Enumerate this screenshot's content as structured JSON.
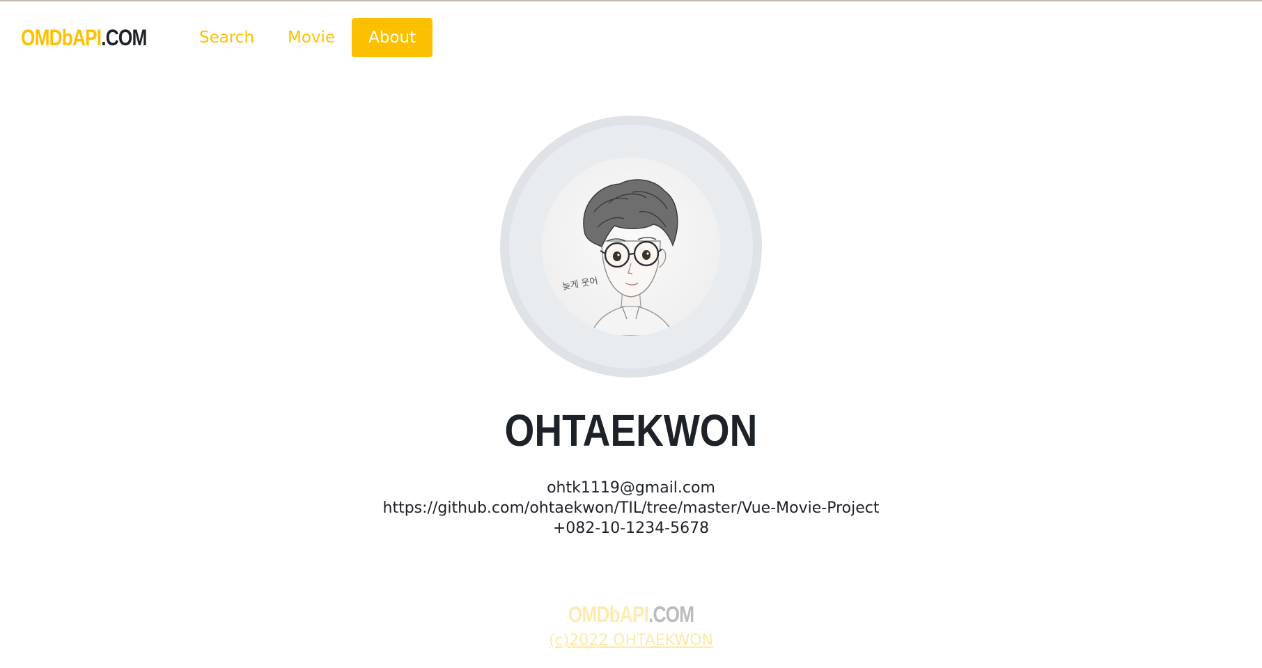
{
  "header": {
    "logo_brand": "OMDbAPI",
    "logo_tld": ".COM",
    "nav": [
      {
        "label": "Search",
        "active": false
      },
      {
        "label": "Movie",
        "active": false
      },
      {
        "label": "About",
        "active": true
      }
    ]
  },
  "profile": {
    "name": "OHTAEKWON",
    "email": "ohtk1119@gmail.com",
    "github": "https://github.com/ohtaekwon/TIL/tree/master/Vue-Movie-Project",
    "phone": "+082-10-1234-5678",
    "photo_caption": "늦게 웃어"
  },
  "footer": {
    "logo_brand": "OMDbAPI",
    "logo_tld": ".COM",
    "copyright": "(c)2022 OHTAEKWON"
  },
  "colors": {
    "accent": "#fdc000",
    "text": "#1d2128",
    "ring": "#dfe3e8"
  }
}
